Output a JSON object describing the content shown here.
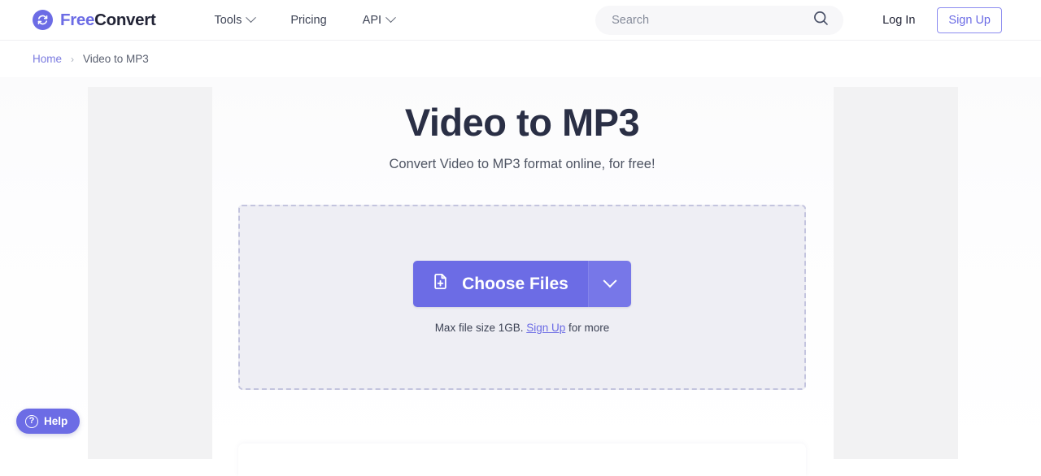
{
  "header": {
    "brand": {
      "part1": "Free",
      "part2": "Convert",
      "icon": "sync-circle-icon"
    },
    "nav": [
      {
        "label": "Tools",
        "has_caret": true
      },
      {
        "label": "Pricing",
        "has_caret": false
      },
      {
        "label": "API",
        "has_caret": true
      }
    ],
    "search": {
      "placeholder": "Search",
      "value": "",
      "icon": "search-icon"
    },
    "login_label": "Log In",
    "signup_label": "Sign Up"
  },
  "breadcrumb": {
    "home": "Home",
    "separator": "›",
    "current": "Video to MP3"
  },
  "main": {
    "title": "Video to MP3",
    "subtitle": "Convert Video to MP3 format online, for free!",
    "dropzone": {
      "choose_files_label": "Choose Files",
      "file_icon": "file-plus-icon",
      "caret_icon": "chevron-down-icon",
      "max_size_prefix": "Max file size 1GB.",
      "max_size_link": "Sign Up",
      "max_size_suffix": "for more"
    }
  },
  "help": {
    "label": "Help",
    "icon": "question-circle-icon"
  },
  "colors": {
    "brand_purple": "#6c6ce5",
    "title_navy": "#2a2f45",
    "dropzone_fill": "#eeeef4",
    "dropzone_border": "#c3c4de",
    "ad_placeholder": "#f2f2f3"
  }
}
